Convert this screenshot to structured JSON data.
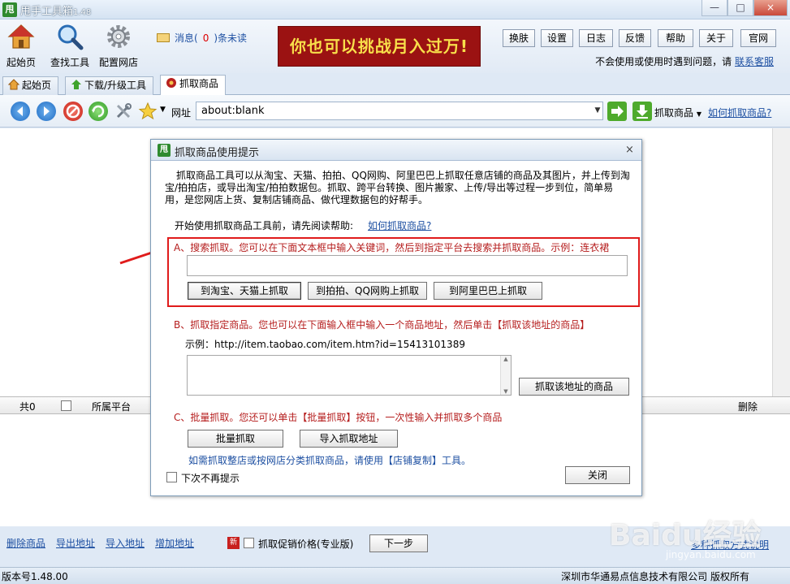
{
  "app": {
    "title": "甩手工具箱",
    "version_label": "1.48",
    "logo_text": "甩"
  },
  "window": {
    "minimize": "—",
    "maximize": "□",
    "close": "×"
  },
  "toolbar": {
    "home": "起始页",
    "find_tools": "查找工具",
    "config_shop": "配置网店",
    "messages": {
      "prefix": "消息(",
      "count": "0",
      "suffix": ")条未读"
    },
    "banner": "你也可以挑战月入过万!",
    "buttons": [
      "换肤",
      "设置",
      "日志",
      "反馈",
      "帮助",
      "关于",
      "官网"
    ],
    "help_text": "不会使用或使用时遇到问题，请",
    "help_link": "联系客服"
  },
  "tabs": [
    {
      "label": "起始页"
    },
    {
      "label": "下载/升级工具"
    },
    {
      "label": "抓取商品"
    }
  ],
  "nav": {
    "url_label": "网址",
    "url_value": "about:blank",
    "grab_label": "抓取商品",
    "how_link": "如何抓取商品?"
  },
  "grid": {
    "total": "共0",
    "platform": "所属平台",
    "delete": "删除"
  },
  "bottom": {
    "delete_goods": "删除商品",
    "export_url": "导出地址",
    "import_url": "导入地址",
    "add_url": "增加地址",
    "new_badge": "新",
    "promo_price": "抓取促销价格(专业版)",
    "next_step": "下一步",
    "methods": "多种抓取方式说明"
  },
  "status": {
    "version": "版本号1.48.00",
    "company": "深圳市华通易点信息技术有限公司 版权所有"
  },
  "dialog": {
    "title": "抓取商品使用提示",
    "close": "×",
    "intro": "抓取商品工具可以从淘宝、天猫、拍拍、QQ网购、阿里巴巴上抓取任意店铺的商品及其图片，并上传到淘宝/拍拍店，或导出淘宝/拍拍数据包。抓取、跨平台转换、图片搬家、上传/导出等过程一步到位，简单易用，是您网店上货、复制店铺商品、做代理数据包的好帮手。",
    "help_prompt": "开始使用抓取商品工具前，请先阅读帮助:",
    "help_link": "如何抓取商品?",
    "sectionA": {
      "title": "A、搜索抓取。您可以在下面文本框中输入关键词，然后到指定平台去搜索并抓取商品。示例：连衣裙",
      "input_value": "",
      "btn_taobao": "到淘宝、天猫上抓取",
      "btn_paipai": "到拍拍、QQ网购上抓取",
      "btn_alibaba": "到阿里巴巴上抓取"
    },
    "sectionB": {
      "title": "B、抓取指定商品。您也可以在下面输入框中输入一个商品地址，然后单击【抓取该地址的商品】",
      "example": "示例：http://item.taobao.com/item.htm?id=15413101389",
      "input_value": "",
      "btn_grab": "抓取该地址的商品"
    },
    "sectionC": {
      "title": "C、批量抓取。您还可以单击【批量抓取】按钮，一次性输入并抓取多个商品",
      "btn_batch": "批量抓取",
      "btn_import": "导入抓取地址",
      "shop_copy": "如需抓取整店或按网店分类抓取商品，请使用【店铺复制】工具。"
    },
    "no_show": "下次不再提示",
    "btn_close": "关闭"
  },
  "watermark": {
    "main": "Baidu经验",
    "sub": "jingyan.baidu.com"
  },
  "colors": {
    "accent": "#1e50a2",
    "highlight": "#e01b1b",
    "section_text": "#b51d1d",
    "banner_bg": "#9b1212",
    "banner_text": "#f8df4a"
  }
}
